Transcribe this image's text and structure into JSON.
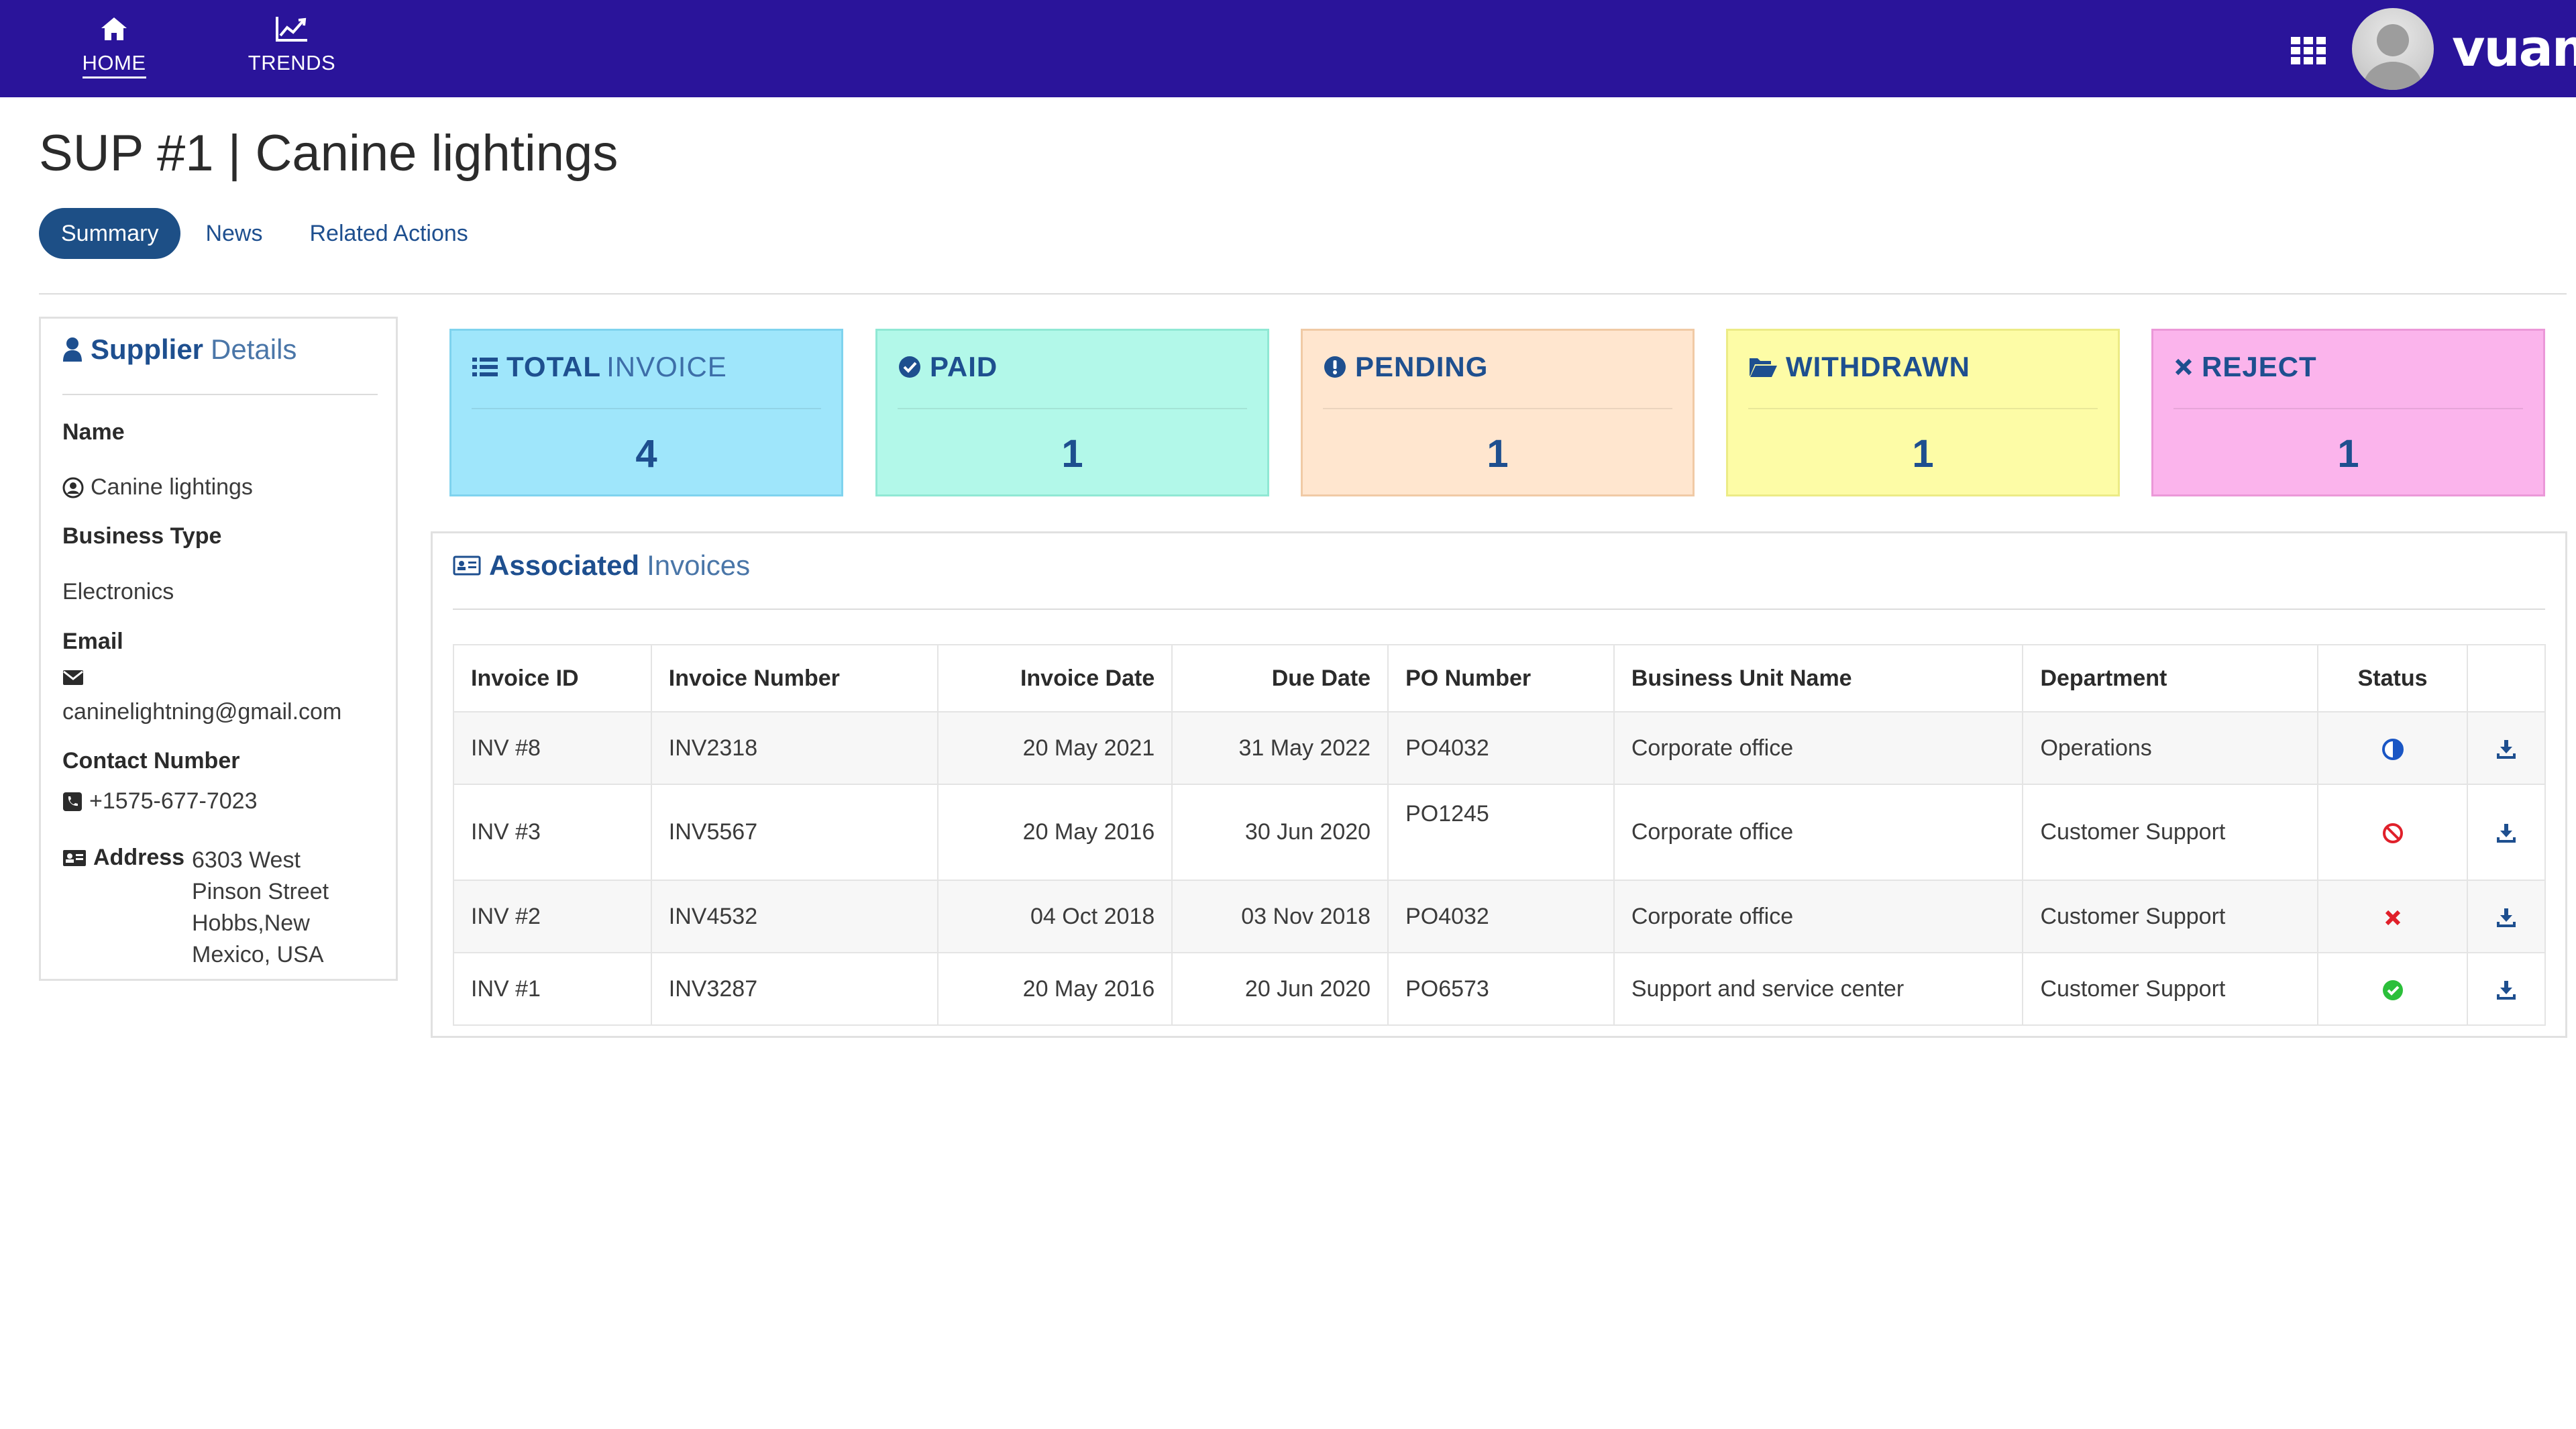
{
  "nav": {
    "items": [
      {
        "label": "HOME",
        "icon": "home-icon",
        "active": true
      },
      {
        "label": "TRENDS",
        "icon": "line-chart-icon",
        "active": false
      }
    ],
    "apps_icon": "grid-icon",
    "logo_text": "vuam"
  },
  "page": {
    "title": "SUP #1 | Canine lightings",
    "tabs": [
      {
        "label": "Summary",
        "active": true
      },
      {
        "label": "News",
        "active": false
      },
      {
        "label": "Related Actions",
        "active": false
      }
    ]
  },
  "supplier": {
    "heading_bold": "Supplier",
    "heading_rest": "Details",
    "name_label": "Name",
    "name_value": "Canine lightings",
    "business_type_label": "Business Type",
    "business_type_value": "Electronics",
    "email_label": "Email",
    "email_value": "caninelightning@gmail.com",
    "contact_label": "Contact Number",
    "contact_value": "+1575-677-7023",
    "address_label": "Address",
    "address_value": "6303 West Pinson Street Hobbs,New Mexico, USA"
  },
  "stats": [
    {
      "title_bold": "TOTAL",
      "title_rest": "INVOICE",
      "value": "4",
      "icon": "list-icon",
      "bg": "#9fe6fb",
      "border": "#7fd3ee"
    },
    {
      "title_bold": "PAID",
      "title_rest": "",
      "value": "1",
      "icon": "check-circle-icon",
      "bg": "#b2f8e9",
      "border": "#90e8d4"
    },
    {
      "title_bold": "PENDING",
      "title_rest": "",
      "value": "1",
      "icon": "exclamation-circle-icon",
      "bg": "#ffe6cf",
      "border": "#f0caa5"
    },
    {
      "title_bold": "WITHDRAWN",
      "title_rest": "",
      "value": "1",
      "icon": "folder-open-icon",
      "bg": "#fdfca6",
      "border": "#eceb86"
    },
    {
      "title_bold": "REJECT",
      "title_rest": "",
      "value": "1",
      "icon": "times-icon",
      "bg": "#fbb4ec",
      "border": "#eb98d8"
    }
  ],
  "invoices": {
    "heading_bold": "Associated",
    "heading_rest": "Invoices",
    "columns": [
      "Invoice ID",
      "Invoice Number",
      "Invoice Date",
      "Due Date",
      "PO Number",
      "Business Unit Name",
      "Department",
      "Status"
    ],
    "rows": [
      {
        "id": "INV #8",
        "number": "INV2318",
        "invoice_date": "20 May 2021",
        "due_date": "31 May 2022",
        "po": "PO4032",
        "unit": "Corporate office",
        "department": "Operations",
        "status": "pending"
      },
      {
        "id": "INV #3",
        "number": "INV5567",
        "invoice_date": "20 May 2016",
        "due_date": "30 Jun 2020",
        "po": "PO1245",
        "unit": "Corporate office",
        "department": "Customer Support",
        "status": "withdrawn"
      },
      {
        "id": "INV #2",
        "number": "INV4532",
        "invoice_date": "04 Oct 2018",
        "due_date": "03 Nov 2018",
        "po": "PO4032",
        "unit": "Corporate office",
        "department": "Customer Support",
        "status": "rejected"
      },
      {
        "id": "INV #1",
        "number": "INV3287",
        "invoice_date": "20 May 2016",
        "due_date": "20 Jun 2020",
        "po": "PO6573",
        "unit": "Support and service center",
        "department": "Customer Support",
        "status": "paid"
      }
    ]
  },
  "colors": {
    "nav_bg": "#2a149a",
    "accent": "#1e4f8f",
    "link": "#1e5aa8",
    "status_pending": "#1a56c4",
    "status_rejected": "#e0202a",
    "status_paid": "#2bbf3a"
  }
}
